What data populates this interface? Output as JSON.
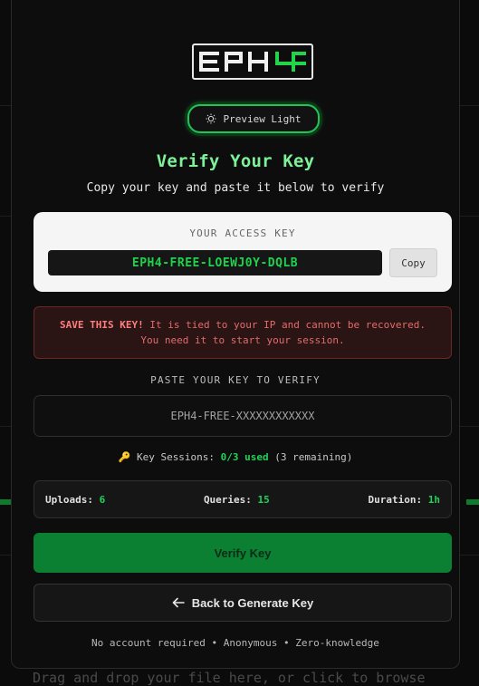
{
  "logo": {
    "text": "EPH4"
  },
  "preview_button": {
    "icon": "sun-icon",
    "label": "Preview Light"
  },
  "title": "Verify Your Key",
  "subtitle": "Copy your key and paste it below to verify",
  "access_key": {
    "label": "YOUR ACCESS KEY",
    "value": "EPH4-FREE-LOEWJ0Y-DQLB",
    "copy_label": "Copy"
  },
  "warning": {
    "strong": "SAVE THIS KEY!",
    "text": " It is tied to your IP and cannot be recovered. You need it to start your session."
  },
  "paste": {
    "label": "PASTE YOUR KEY TO VERIFY",
    "placeholder": "EPH4-FREE-XXXXXXXXXXXX"
  },
  "sessions": {
    "icon": "key-icon",
    "prefix": "Key Sessions:",
    "used": "0/3 used",
    "remaining": "(3 remaining)"
  },
  "stats": [
    {
      "label": "Uploads:",
      "value": "6"
    },
    {
      "label": "Queries:",
      "value": "15"
    },
    {
      "label": "Duration:",
      "value": "1h"
    }
  ],
  "verify_button": "Verify Key",
  "back_button": {
    "icon": "arrow-left-icon",
    "label": "Back to Generate Key"
  },
  "footer": "No account required • Anonymous • Zero-knowledge",
  "background": {
    "drop_text": "Drag and drop your file here, or click to browse"
  },
  "colors": {
    "accent": "#23c456",
    "title": "#7ef29a",
    "verify_bg": "#0b7f32",
    "warning_text": "#e26c6c"
  }
}
